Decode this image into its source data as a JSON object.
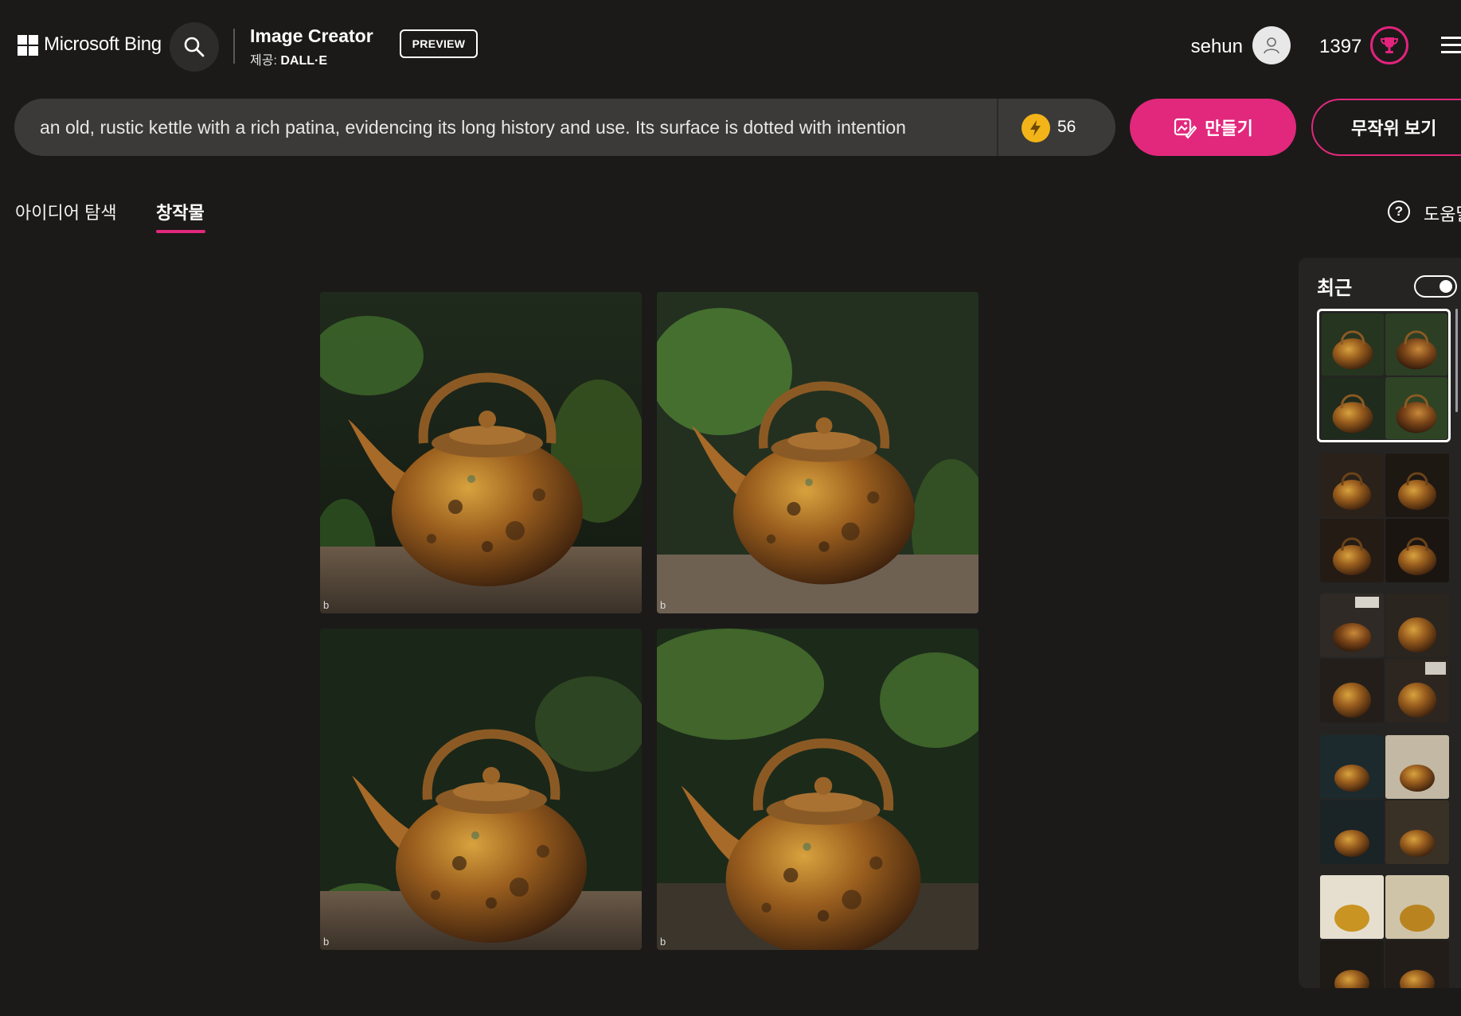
{
  "header": {
    "brand": "Microsoft Bing",
    "app_title": "Image Creator",
    "app_sub_prefix": "제공: ",
    "app_sub_model": "DALL·E",
    "preview_badge": "PREVIEW",
    "username": "sehun",
    "points": "1397"
  },
  "prompt": {
    "value": "an old, rustic kettle with a rich patina, evidencing its long history and use. Its surface is dotted with intention",
    "boost_count": "56",
    "create_label": "만들기",
    "random_label": "무작위 보기"
  },
  "tabs": {
    "explore": "아이디어 탐색",
    "creations": "창작물",
    "help": "도움말"
  },
  "results": {
    "watermark": "b"
  },
  "recent": {
    "title": "최근"
  },
  "colors": {
    "accent": "#e2287c",
    "background": "#1b1a19",
    "panel": "#252423",
    "boost": "#f2b418"
  }
}
